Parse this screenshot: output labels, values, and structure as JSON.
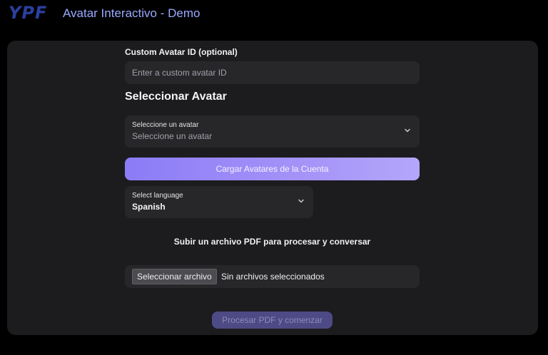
{
  "header": {
    "logo_text": "YPF",
    "title": "Avatar Interactivo - Demo"
  },
  "form": {
    "custom_id": {
      "label": "Custom Avatar ID (optional)",
      "placeholder": "Enter a custom avatar ID",
      "value": ""
    },
    "section_title": "Seleccionar Avatar",
    "avatar_select": {
      "label": "Seleccione un avatar",
      "value": "Seleccione un avatar",
      "icon": "chevron-down-icon"
    },
    "load_button_label": "Cargar Avatares de la Cuenta",
    "language_select": {
      "label": "Select language",
      "value": "Spanish",
      "icon": "chevron-down-icon"
    },
    "pdf_instruction": "Subir un archivo PDF para procesar y conversar",
    "file_input": {
      "button_label": "Seleccionar archivo",
      "status": "Sin archivos seleccionados"
    },
    "process_button_label": "Procesar PDF y comenzar"
  },
  "colors": {
    "background": "#000000",
    "panel": "#1c1c1f",
    "field": "#27272a",
    "accent": "#a593f8",
    "title": "#9aa9ff",
    "logo": "#2b3f9e",
    "disabled_button": "#4d4a85"
  }
}
